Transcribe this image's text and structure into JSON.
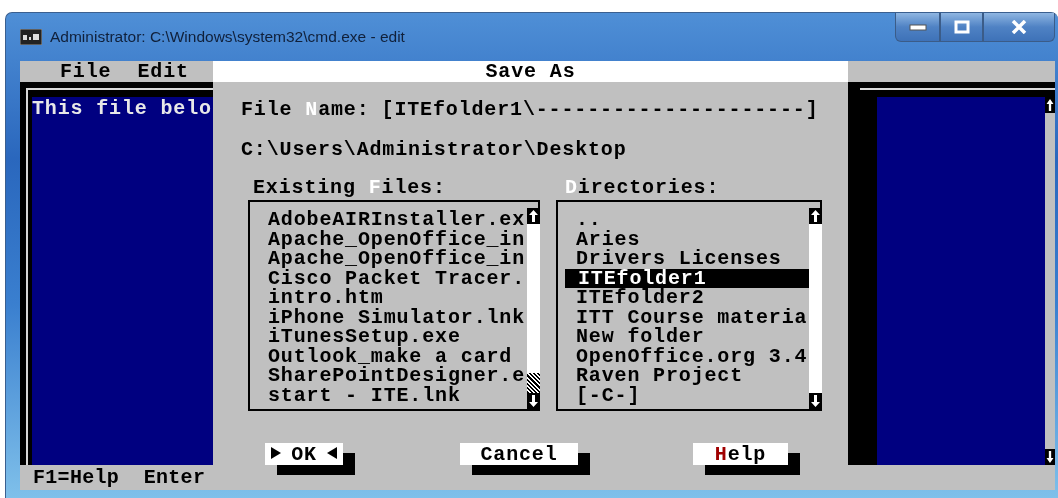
{
  "window": {
    "title": "Administrator: C:\\Windows\\system32\\cmd.exe - edit"
  },
  "editor": {
    "menu": [
      {
        "label": "File"
      },
      {
        "label": "Edit"
      }
    ],
    "text": "This file belo",
    "status": "F1=Help  Enter"
  },
  "dialog": {
    "title": "Save As",
    "file_name": {
      "label": {
        "before": "File ",
        "hotkey": "N",
        "after": "ame:"
      },
      "value": "[ITEfolder1\\---------------------]"
    },
    "path": "C:\\Users\\Administrator\\Desktop",
    "files": {
      "label": {
        "before": "Existing ",
        "hotkey": "F",
        "after": "iles:"
      },
      "items": [
        {
          "name": "AdobeAIRInstaller.ex",
          "selected": false
        },
        {
          "name": "Apache_OpenOffice_in",
          "selected": false
        },
        {
          "name": "Apache_OpenOffice_in",
          "selected": false
        },
        {
          "name": "Cisco Packet Tracer.",
          "selected": false
        },
        {
          "name": "intro.htm",
          "selected": false
        },
        {
          "name": "iPhone Simulator.lnk",
          "selected": false
        },
        {
          "name": "iTunesSetup.exe",
          "selected": false
        },
        {
          "name": "Outlook_make a card",
          "selected": false
        },
        {
          "name": "SharePointDesigner.e",
          "selected": false
        },
        {
          "name": "start - ITE.lnk",
          "selected": false
        }
      ]
    },
    "directories": {
      "label": {
        "hotkey": "D",
        "after": "irectories:"
      },
      "items": [
        {
          "name": "..",
          "selected": false
        },
        {
          "name": "Aries",
          "selected": false
        },
        {
          "name": "Drivers Licenses",
          "selected": false
        },
        {
          "name": "ITEfolder1",
          "selected": true
        },
        {
          "name": "ITEfolder2",
          "selected": false
        },
        {
          "name": "ITT Course materia",
          "selected": false
        },
        {
          "name": "New folder",
          "selected": false
        },
        {
          "name": "OpenOffice.org 3.4",
          "selected": false
        },
        {
          "name": "Raven Project",
          "selected": false
        },
        {
          "name": "[-C-]",
          "selected": false
        }
      ]
    },
    "buttons": [
      {
        "label": {
          "before": "OK"
        },
        "default": true
      },
      {
        "label": {
          "before": "Cancel"
        },
        "default": false
      },
      {
        "label": {
          "hotkey": "H",
          "after": "elp"
        },
        "default": false
      }
    ]
  }
}
